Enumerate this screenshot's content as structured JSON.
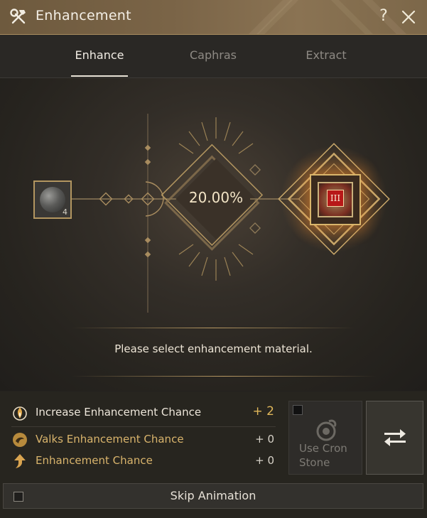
{
  "window": {
    "title": "Enhancement",
    "help_label": "?"
  },
  "tabs": [
    {
      "label": "Enhance",
      "active": true
    },
    {
      "label": "Caphras",
      "active": false
    },
    {
      "label": "Extract",
      "active": false
    }
  ],
  "stage": {
    "material_count": "4",
    "success_chance": "20.00%",
    "target_grade": "III",
    "hint": "Please select enhancement material."
  },
  "stats": [
    {
      "label": "Increase Enhancement Chance",
      "value": "+ 2",
      "icon": "failstack-icon"
    },
    {
      "label": "Valks Enhancement Chance",
      "value": "+ 0",
      "icon": "valks-icon"
    },
    {
      "label": "Enhancement Chance",
      "value": "+ 0",
      "icon": "arrow-up-icon"
    }
  ],
  "cron": {
    "line1": "Use Cron",
    "line2": "Stone",
    "checked": false
  },
  "skip": {
    "label": "Skip Animation",
    "checked": false
  },
  "colors": {
    "title_bar": "#7a6447",
    "accent_gold": "#d9b46c",
    "failstack_value": "#e0b75a",
    "target_badge": "#b81818"
  }
}
